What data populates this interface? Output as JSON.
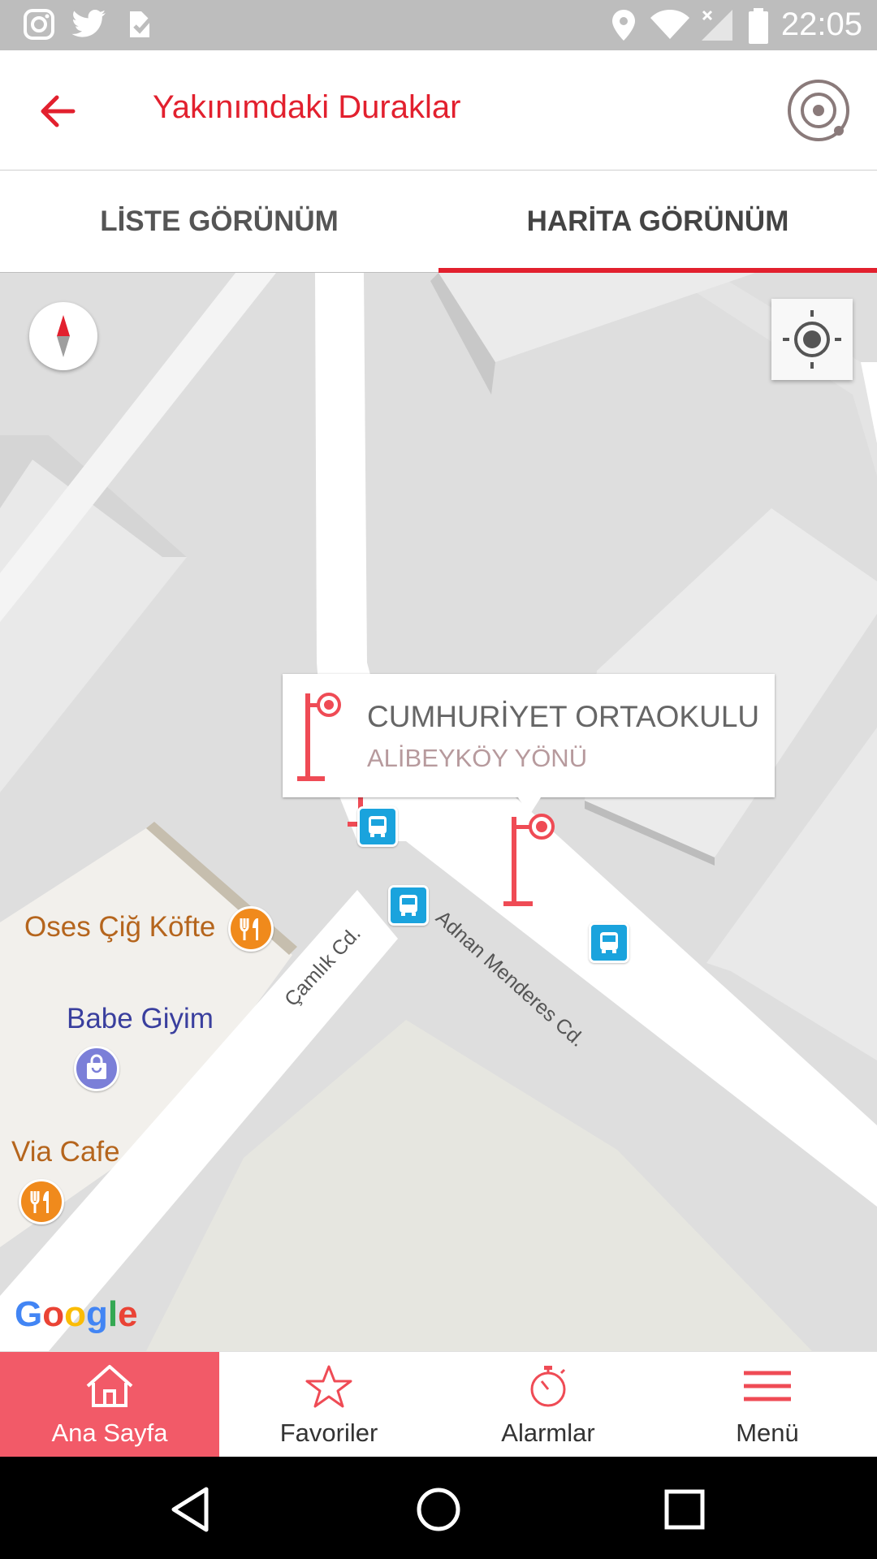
{
  "status_bar": {
    "time": "22:05",
    "icons": [
      "instagram-icon",
      "twitter-icon",
      "check-notification-icon",
      "location-icon",
      "wifi-icon",
      "signal-icon",
      "battery-icon"
    ]
  },
  "app_bar": {
    "title": "Yakınımdaki Duraklar",
    "back_icon": "arrow-left-icon",
    "action_icon": "target-icon"
  },
  "tabs": [
    {
      "label": "LİSTE GÖRÜNÜM",
      "active": false
    },
    {
      "label": "HARİTA GÖRÜNÜM",
      "active": true
    }
  ],
  "map": {
    "callout": {
      "title": "CUMHURİYET ORTAOKULU",
      "subtitle": "ALİBEYKÖY YÖNÜ"
    },
    "pois": [
      {
        "label": "Oses Çiğ Köfte",
        "type": "restaurant",
        "color": "#b5651d"
      },
      {
        "label": "Babe Giyim",
        "type": "shopping",
        "color": "#3a3f9e"
      },
      {
        "label": "Via Cafe",
        "type": "restaurant",
        "color": "#b5651d"
      }
    ],
    "roads": [
      {
        "label": "Çamlık Cd."
      },
      {
        "label": "Adnan Menderes Cd."
      }
    ],
    "attribution": "Google"
  },
  "bottom_nav": [
    {
      "label": "Ana Sayfa",
      "icon": "home-icon",
      "active": true
    },
    {
      "label": "Favoriler",
      "icon": "star-icon",
      "active": false
    },
    {
      "label": "Alarmlar",
      "icon": "stopwatch-icon",
      "active": false
    },
    {
      "label": "Menü",
      "icon": "hamburger-menu-icon",
      "active": false
    }
  ],
  "colors": {
    "accent": "#e2202e",
    "active_nav": "#f25a68",
    "bus_stop_pin": "#ef4b55",
    "bus_icon": "#1aa3dd"
  }
}
